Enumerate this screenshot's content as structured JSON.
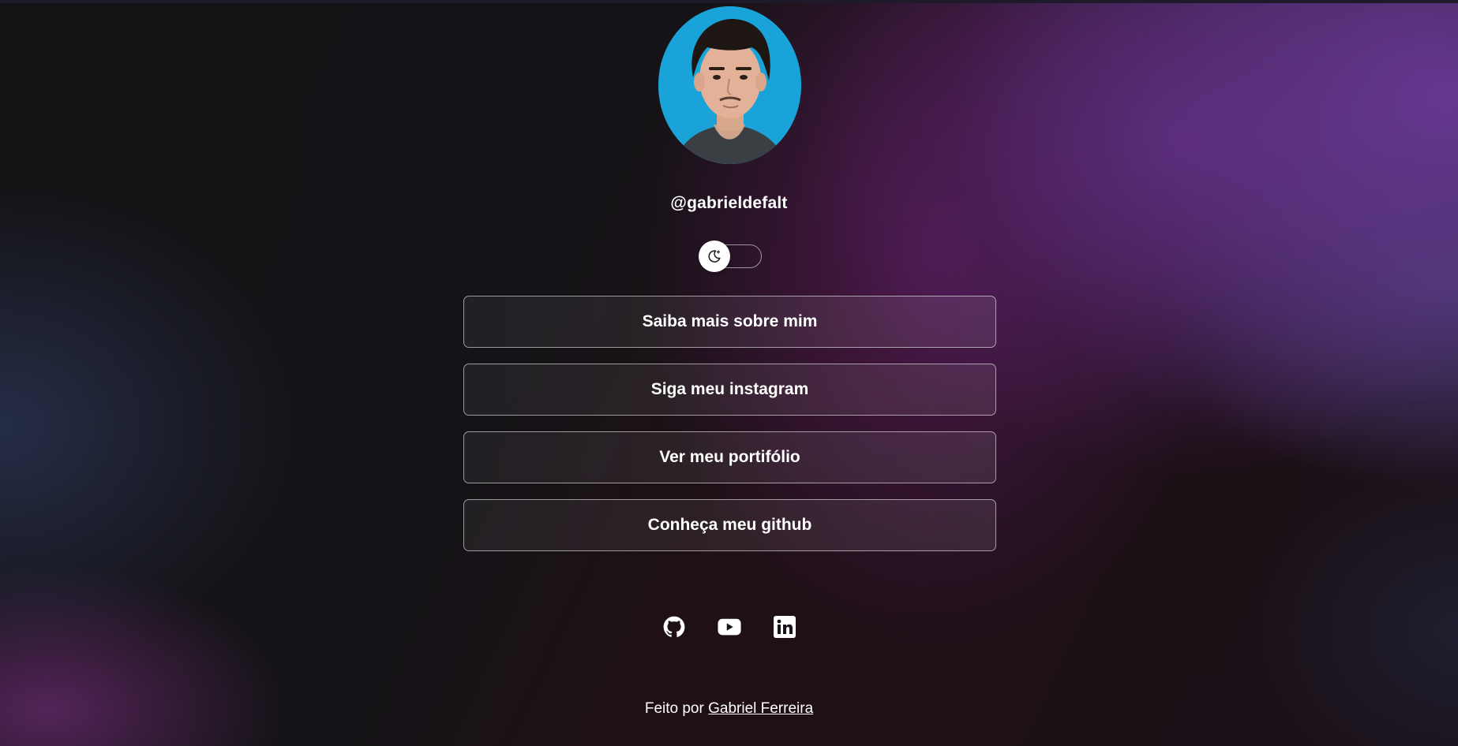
{
  "profile": {
    "handle": "@gabrieldefalt",
    "avatar_icon": "profile-photo"
  },
  "theme_toggle": {
    "icon": "moon-stars-icon",
    "state": "dark"
  },
  "links": [
    {
      "label": "Saiba mais sobre mim"
    },
    {
      "label": "Siga meu instagram"
    },
    {
      "label": "Ver meu portifólio"
    },
    {
      "label": "Conheça meu github"
    }
  ],
  "socials": [
    {
      "icon": "github-icon"
    },
    {
      "icon": "youtube-icon"
    },
    {
      "icon": "linkedin-icon"
    }
  ],
  "footer": {
    "prefix": "Feito por",
    "author": "Gabriel Ferreira"
  },
  "colors": {
    "background_dark": "#141216",
    "accent_purple": "#683a96",
    "text": "#ffffff",
    "avatar_bg": "#1aa3d8"
  }
}
